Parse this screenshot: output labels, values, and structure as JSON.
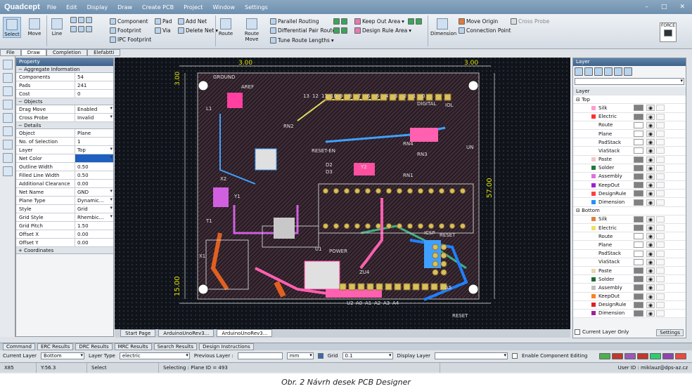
{
  "app": {
    "title": "Quadcept",
    "menu": [
      "File",
      "Edit",
      "Display",
      "Draw",
      "Create PCB",
      "Project",
      "Window",
      "Settings"
    ]
  },
  "ribbon": {
    "select": "Select",
    "move": "Move",
    "line": "Line",
    "component": "Component",
    "footprint": "Footprint",
    "ipc_footprint": "IPC Footprint",
    "pad": "Pad",
    "via": "Via",
    "add_net": "Add Net",
    "delete_net": "Delete Net",
    "route": "Route",
    "route_move": "Route Move",
    "parallel_routing": "Parallel Routing",
    "differential_pair": "Differential Pair Routes",
    "tune_route": "Tune Route Lengths",
    "keep_out": "Keep Out Area",
    "design_rule_area": "Design Rule Area",
    "dimension": "Dimension",
    "move_origin": "Move Origin",
    "connection_point": "Connection Point",
    "cross_probe": "Cross Probe",
    "force": "FORCE"
  },
  "tabs": [
    "File",
    "Draw",
    "Completion",
    "Elefabtti"
  ],
  "property": {
    "title": "Property",
    "aggregate": {
      "title": "Aggregate Information",
      "rows": [
        [
          "Components",
          "54"
        ],
        [
          "Pads",
          "241"
        ],
        [
          "Cost",
          "0"
        ]
      ]
    },
    "objects": {
      "title": "Objects",
      "rows": [
        [
          "Drag Move",
          "Enabled"
        ],
        [
          "Cross Probe",
          "Invalid"
        ]
      ]
    },
    "details": {
      "title": "Details",
      "rows": [
        [
          "Object",
          "Plane"
        ],
        [
          "No. of Selection",
          "1"
        ],
        [
          "Layer",
          "Top"
        ],
        [
          "Net Color",
          ""
        ],
        [
          "Outline Width",
          "0.50"
        ],
        [
          "Filled Line Width",
          "0.50"
        ],
        [
          "Additional Clearance",
          "0.00"
        ],
        [
          "Net Name",
          "GND"
        ],
        [
          "Plane Type",
          "Dynamic..."
        ],
        [
          "Style",
          "Grid"
        ],
        [
          "Grid Style",
          "Rhembic..."
        ],
        [
          "Grid Pitch",
          "1.50"
        ],
        [
          "Offset X",
          "0.00"
        ],
        [
          "Offset Y",
          "0.00"
        ]
      ]
    },
    "coordinates": "Coordinates"
  },
  "canvas": {
    "dim_top_left": "3.00",
    "dim_top_right": "3.00",
    "dim_right": "57.00",
    "dim_left": "15.00",
    "dim_left_top": "3.00",
    "labels": [
      "GROUND",
      "AREF",
      "13",
      "12",
      "11",
      "10",
      "9",
      "8",
      "7",
      "6",
      "5",
      "4",
      "3",
      "2",
      "1",
      "0",
      "DIGITAL",
      "IOL",
      "RN2",
      "RESET-EN",
      "RN4",
      "RN1",
      "Y2",
      "D2",
      "D3",
      "X2",
      "L1",
      "Y1",
      "T1",
      "X1",
      "U1",
      "IC1",
      "UN",
      "RESET",
      "ICSP",
      "ZU4",
      "POWER",
      "U2",
      "A0",
      "A1",
      "A2",
      "A3",
      "A4",
      "A5",
      "RN3",
      "RESET"
    ]
  },
  "doctabs": [
    "Start Page",
    "ArduinoUnoRev3...",
    "ArduinoUnoRev3..."
  ],
  "layer": {
    "title": "Layer",
    "col": "Layer",
    "top": "Top",
    "bottom": "Bottom",
    "top_rows": [
      [
        "Silk",
        "#ff9ad0"
      ],
      [
        "Electric",
        "#ff3030"
      ],
      [
        "Route",
        ""
      ],
      [
        "Plane",
        ""
      ],
      [
        "PadStack",
        ""
      ],
      [
        "ViaStack",
        ""
      ],
      [
        "Paste",
        "#f0c8c8"
      ],
      [
        "Solder",
        "#1e7a3a"
      ],
      [
        "Assembly",
        "#e070e0"
      ],
      [
        "KeepOut",
        "#a020d0"
      ],
      [
        "DesignRule",
        "#ff4040"
      ],
      [
        "Dimension",
        "#2090ff"
      ]
    ],
    "bottom_rows": [
      [
        "Silk",
        "#e08040"
      ],
      [
        "Electric",
        "#f0e060"
      ],
      [
        "Route",
        ""
      ],
      [
        "Plane",
        ""
      ],
      [
        "PadStack",
        ""
      ],
      [
        "ViaStack",
        ""
      ],
      [
        "Paste",
        "#e8d8b0"
      ],
      [
        "Solder",
        "#1e6a30"
      ],
      [
        "Assembly",
        "#c0c0c0"
      ],
      [
        "KeepOut",
        "#ff8020"
      ],
      [
        "DesignRule",
        "#e02020"
      ],
      [
        "Dimension",
        "#a020a0"
      ]
    ],
    "current_only": "Current Layer Only",
    "settings": "Settings"
  },
  "bottom_tabs": [
    "Command",
    "ERC Results",
    "DRC Results",
    "MRC Results",
    "Search Results",
    "Design Instructions"
  ],
  "options": {
    "current_layer_label": "Current Layer",
    "current_layer": "Bottom",
    "layer_type_label": "Layer Type",
    "layer_type": "electric",
    "prev_layer_label": "Previous Layer :",
    "unit": "mm",
    "grid_label": "Grid",
    "grid": "0.1",
    "display_layer_label": "Display Layer",
    "comp_edit": "Enable Component Editing"
  },
  "status": {
    "x": "X85",
    "y": "Y:56.3",
    "mode": "Select",
    "selecting": "Selecting : Plane  ID = 493",
    "user": "User ID : miklauz@dps-az.cz"
  },
  "caption": "Obr. 2  Návrh desek PCB Designer"
}
